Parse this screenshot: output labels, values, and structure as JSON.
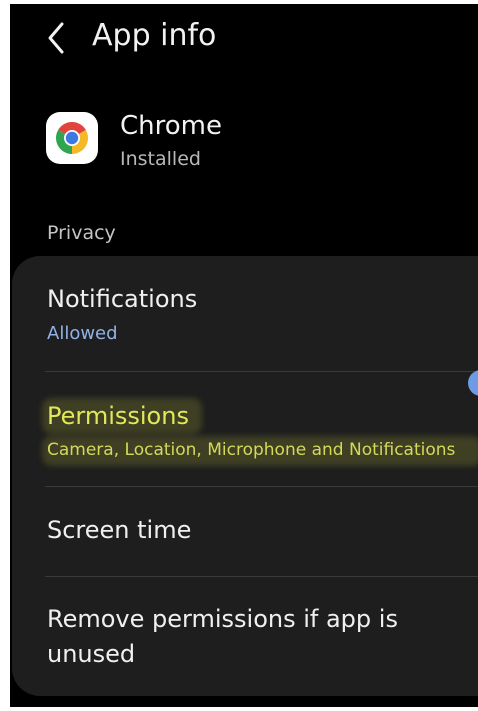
{
  "header": {
    "title": "App info"
  },
  "app": {
    "name": "Chrome",
    "status": "Installed"
  },
  "section": {
    "label": "Privacy"
  },
  "privacy_items": [
    {
      "title": "Notifications",
      "subtitle": "Allowed"
    },
    {
      "title": "Permissions",
      "subtitle": "Camera, Location, Microphone and Notifications",
      "highlighted": true
    },
    {
      "title": "Screen time"
    },
    {
      "title": "Remove permissions if app is unused",
      "toggle": "on"
    }
  ],
  "colors": {
    "background": "#000000",
    "card": "#1e1e1e",
    "accent_blue": "#8fb3e6",
    "highlight": "#e3e85a"
  },
  "icons": {
    "back": "chevron-left-icon",
    "app": "chrome-logo-icon"
  }
}
